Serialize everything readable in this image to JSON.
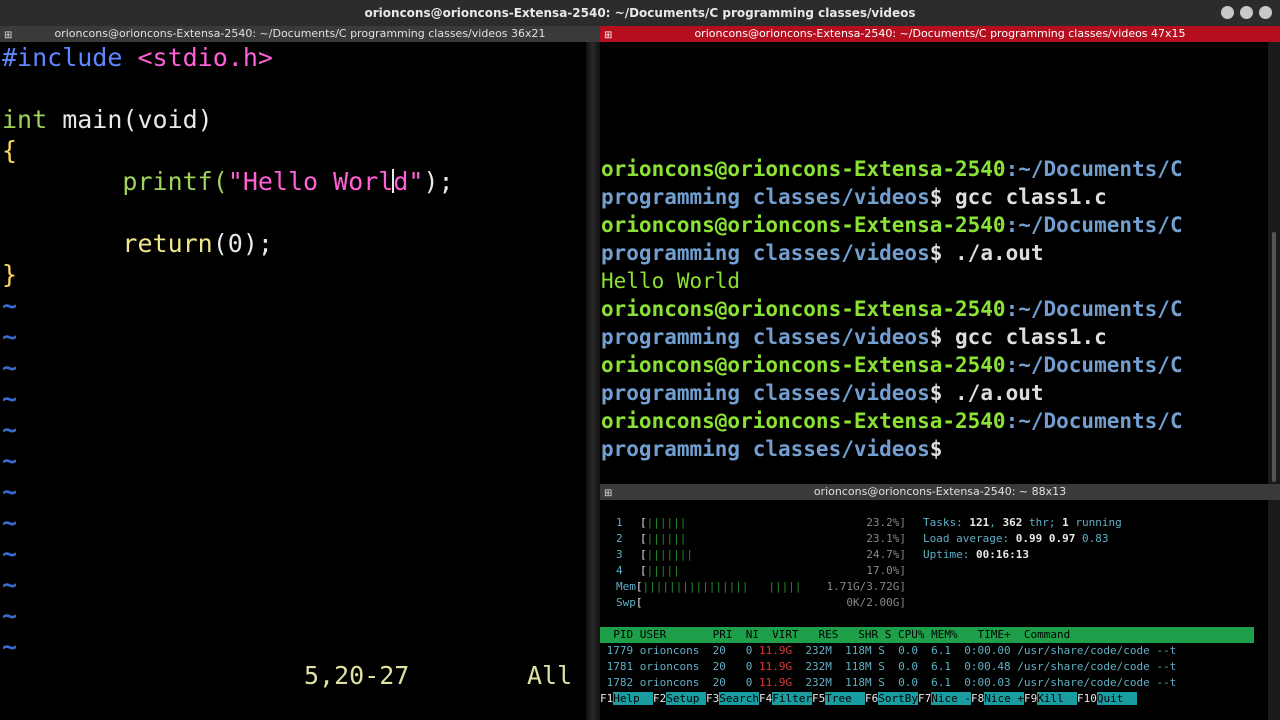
{
  "window": {
    "title": "orioncons@orioncons-Extensa-2540: ~/Documents/C programming classes/videos"
  },
  "panes": {
    "vim_title": "orioncons@orioncons-Extensa-2540: ~/Documents/C programming classes/videos 36x21",
    "terminal_title": "orioncons@orioncons-Extensa-2540: ~/Documents/C programming classes/videos 47x15",
    "htop_title": "orioncons@orioncons-Extensa-2540: ~ 88x13"
  },
  "vim": {
    "code": {
      "l1_pre": "#include ",
      "l1_inc": "<stdio.h>",
      "l3_type": "int",
      "l3_rest": " main(void)",
      "l4_brace": "{",
      "l5_indent": "        ",
      "l5_fn": "printf(",
      "l5_str_a": "\"Hello Worl",
      "l5_str_b": "d\"",
      "l5_end": ");",
      "l7_indent": "        ",
      "l7_kw": "return",
      "l7_rest": "(0);",
      "l8_brace": "}",
      "tilde": "~"
    },
    "status_position": "5,20-27",
    "status_scroll": "All"
  },
  "terminal": {
    "user_host": "orioncons@orioncons-Extensa-2540",
    "path_a": ":~/Documents/C",
    "path_b": "programming classes/videos",
    "prompt_end": "$ ",
    "cmd_compile": "gcc class1.c",
    "cmd_run": "./a.out",
    "output": "Hello World"
  },
  "htop": {
    "cpus": [
      {
        "num": "1",
        "pct": "23.2%]"
      },
      {
        "num": "2",
        "pct": "23.1%]"
      },
      {
        "num": "3",
        "pct": "24.7%]"
      },
      {
        "num": "4",
        "pct": "17.0%]"
      }
    ],
    "mem_label": "Mem",
    "mem_value": "1.71G/3.72G]",
    "swp_label": "Swp",
    "swp_value": "0K/2.00G]",
    "tasks_label": "Tasks: ",
    "tasks_count": "121",
    "tasks_sep": ", ",
    "threads_count": "362",
    "threads_label": " thr; ",
    "running_count": "1",
    "running_label": " running",
    "load_label": "Load average: ",
    "load_1": "0.99",
    "load_5": "0.97",
    "load_15": "0.83",
    "uptime_label": "Uptime: ",
    "uptime_value": "00:16:13",
    "columns": "  PID USER       PRI  NI  VIRT   RES   SHR S CPU% MEM%   TIME+  Command",
    "processes": [
      {
        "pid": " 1779",
        "user": " orioncons ",
        "pri": " 20",
        "ni": "   0",
        "virt": " 11.9G",
        "rest": "  232M  118M S  0.0  6.1  0:00.00 /usr/share/code/code --t"
      },
      {
        "pid": " 1781",
        "user": " orioncons ",
        "pri": " 20",
        "ni": "   0",
        "virt": " 11.9G",
        "rest": "  232M  118M S  0.0  6.1  0:00.48 /usr/share/code/code --t"
      },
      {
        "pid": " 1782",
        "user": " orioncons ",
        "pri": " 20",
        "ni": "   0",
        "virt": " 11.9G",
        "rest": "  232M  118M S  0.0  6.1  0:00.03 /usr/share/code/code --t"
      }
    ],
    "fkeys": [
      {
        "key": "F1",
        "label": "Help  "
      },
      {
        "key": "F2",
        "label": "Setup "
      },
      {
        "key": "F3",
        "label": "Search"
      },
      {
        "key": "F4",
        "label": "Filter"
      },
      {
        "key": "F5",
        "label": "Tree  "
      },
      {
        "key": "F6",
        "label": "SortBy"
      },
      {
        "key": "F7",
        "label": "Nice -"
      },
      {
        "key": "F8",
        "label": "Nice +"
      },
      {
        "key": "F9",
        "label": "Kill  "
      },
      {
        "key": "F10",
        "label": "Quit  "
      }
    ]
  }
}
